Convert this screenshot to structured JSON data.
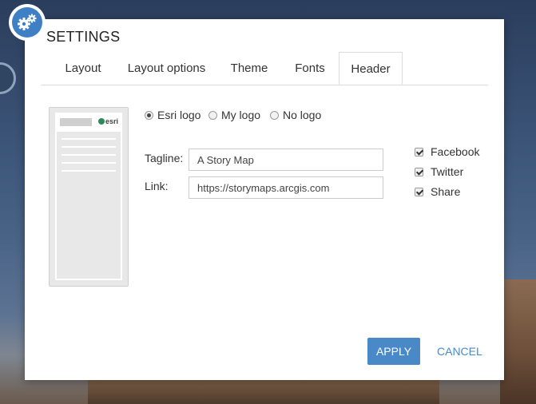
{
  "dialog": {
    "title": "SETTINGS",
    "accent_color": "#4a89c8"
  },
  "tabs": [
    {
      "label": "Layout",
      "active": false
    },
    {
      "label": "Layout options",
      "active": false
    },
    {
      "label": "Theme",
      "active": false
    },
    {
      "label": "Fonts",
      "active": false
    },
    {
      "label": "Header",
      "active": true
    }
  ],
  "preview": {
    "logo_text": "esri"
  },
  "logo_options": [
    {
      "label": "Esri logo",
      "selected": true
    },
    {
      "label": "My logo",
      "selected": false
    },
    {
      "label": "No logo",
      "selected": false
    }
  ],
  "fields": {
    "tagline_label": "Tagline:",
    "tagline_value": "A Story Map",
    "link_label": "Link:",
    "link_value": "https://storymaps.arcgis.com"
  },
  "checkboxes": [
    {
      "label": "Facebook",
      "checked": true
    },
    {
      "label": "Twitter",
      "checked": true
    },
    {
      "label": "Share",
      "checked": true
    }
  ],
  "buttons": {
    "apply": "APPLY",
    "cancel": "CANCEL"
  },
  "icons": {
    "settings": "gears-icon"
  }
}
